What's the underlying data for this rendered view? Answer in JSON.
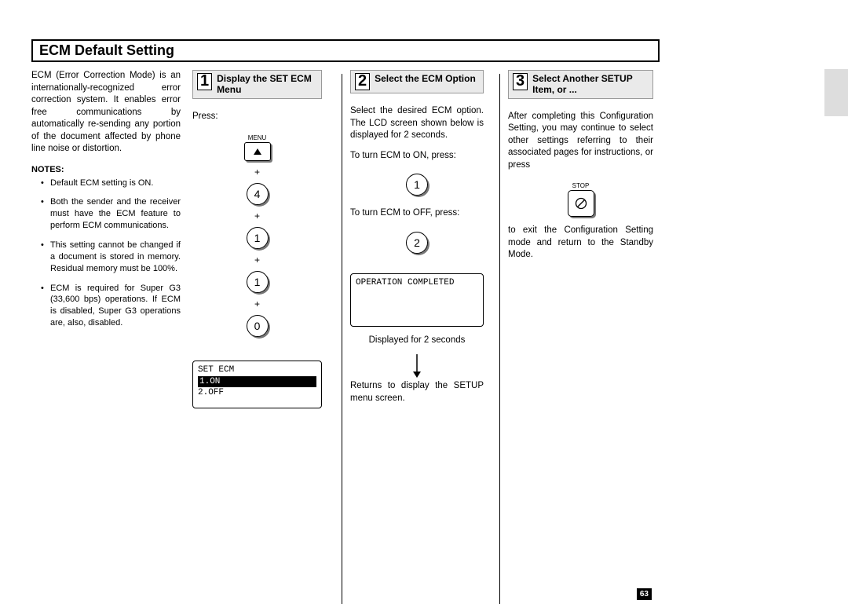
{
  "page_number": "63",
  "title": "ECM Default Setting",
  "intro": "ECM (Error Correction Mode) is an internationally-recognized error correction system. It enables error free communications by automatically re-sending any portion of the document affected by phone line noise or distortion.",
  "notes_header": "NOTES:",
  "notes": [
    "Default ECM setting is ON.",
    "Both the sender and the receiver must have the ECM feature to perform ECM communications.",
    "This setting cannot be changed if a document is stored in memory. Residual memory must be 100%.",
    "ECM is required for Super G3 (33,600 bps) operations. If ECM is disabled, Super G3 operations are, also, disabled."
  ],
  "step1": {
    "num": "1",
    "title": "Display the SET ECM Menu",
    "press": "Press:",
    "menu_label": "MENU",
    "sequence_keys": [
      "4",
      "1",
      "1",
      "0"
    ],
    "plus": "+",
    "lcd_title": "SET ECM",
    "lcd_opt1": "1.ON",
    "lcd_opt2": "2.OFF"
  },
  "step2": {
    "num": "2",
    "title": "Select the ECM Option",
    "intro": "Select the desired ECM option. The LCD screen shown below is displayed for 2 seconds.",
    "on_text": "To turn ECM to ON, press:",
    "on_key": "1",
    "off_text": "To turn ECM to OFF, press:",
    "off_key": "2",
    "lcd_msg": "OPERATION COMPLETED",
    "disp_text": "Displayed for 2 seconds",
    "return_text": "Returns to display the SETUP menu screen."
  },
  "step3": {
    "num": "3",
    "title": "Select Another SETUP Item, or ...",
    "intro": "After completing this Configuration Setting, you may continue to select other settings referring to their associated pages for instructions, or press",
    "stop_label": "STOP",
    "exit_text": "to exit the Configuration Setting mode and return to the Standby Mode."
  }
}
